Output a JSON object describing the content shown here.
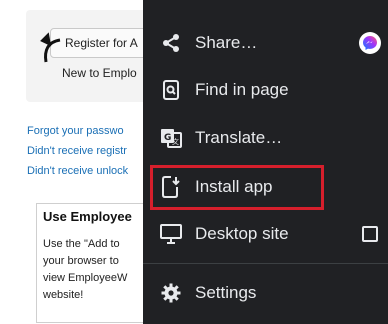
{
  "page": {
    "register_button": "Register for A",
    "new_to": "New to Emplo",
    "links": [
      "Forgot your passwo",
      "Didn't receive registr",
      "Didn't receive unlock"
    ],
    "info_title": "Use Employee",
    "info_lines": [
      "Use the \"Add to",
      "your browser to",
      "view EmployeeW",
      "website!"
    ]
  },
  "menu": {
    "share_label": "Share…",
    "find_label": "Find in page",
    "translate_label": "Translate…",
    "install_label": "Install app",
    "desktop_label": "Desktop site",
    "settings_label": "Settings",
    "desktop_checked": false,
    "highlight_color": "#d61f2c",
    "background": "#202124"
  }
}
